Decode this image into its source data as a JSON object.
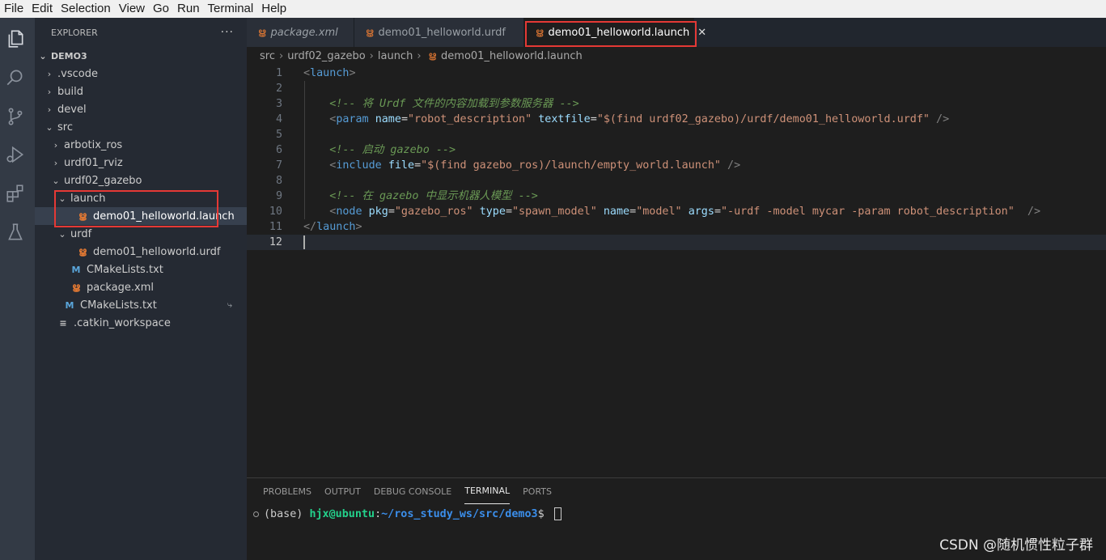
{
  "menubar": {
    "items": [
      "File",
      "Edit",
      "Selection",
      "View",
      "Go",
      "Run",
      "Terminal",
      "Help"
    ]
  },
  "activity_bar": {
    "icons": [
      "files-icon",
      "search-icon",
      "source-control-icon",
      "run-debug-icon",
      "extensions-icon",
      "testing-flask-icon"
    ]
  },
  "sidebar": {
    "title": "EXPLORER",
    "more": "···",
    "workspace": "DEMO3",
    "tree": [
      {
        "label": ".vscode",
        "type": "folder",
        "expanded": false
      },
      {
        "label": "build",
        "type": "folder",
        "expanded": false
      },
      {
        "label": "devel",
        "type": "folder",
        "expanded": false
      },
      {
        "label": "src",
        "type": "folder",
        "expanded": true
      },
      {
        "label": "arbotix_ros",
        "type": "folder",
        "expanded": false
      },
      {
        "label": "urdf01_rviz",
        "type": "folder",
        "expanded": false
      },
      {
        "label": "urdf02_gazebo",
        "type": "folder",
        "expanded": true
      },
      {
        "label": "launch",
        "type": "folder",
        "expanded": true
      },
      {
        "label": "demo01_helloworld.launch",
        "type": "rss-file"
      },
      {
        "label": "urdf",
        "type": "folder",
        "expanded": true
      },
      {
        "label": "demo01_helloworld.urdf",
        "type": "rss-file"
      },
      {
        "label": "CMakeLists.txt",
        "type": "cmake-file"
      },
      {
        "label": "package.xml",
        "type": "rss-file"
      },
      {
        "label": "CMakeLists.txt",
        "type": "cmake-file"
      },
      {
        "label": ".catkin_workspace",
        "type": "text-file"
      }
    ],
    "chevron_open": "⌄",
    "chevron_closed": "›",
    "rss_glyph": "ൠ",
    "cmake_glyph": "M",
    "text_glyph": "≡",
    "return_glyph": "⤷"
  },
  "tabs": [
    {
      "label": "package.xml",
      "italic": true,
      "active": false
    },
    {
      "label": "demo01_helloworld.urdf",
      "italic": false,
      "active": false
    },
    {
      "label": "demo01_helloworld.launch",
      "italic": false,
      "active": true,
      "close": "✕"
    }
  ],
  "breadcrumb": [
    "src",
    "urdf02_gazebo",
    "launch",
    "demo01_helloworld.launch"
  ],
  "editor": {
    "line_numbers": [
      "1",
      "2",
      "3",
      "4",
      "5",
      "6",
      "7",
      "8",
      "9",
      "10",
      "11",
      "12"
    ],
    "lines": [
      [
        [
          "bracket",
          "<"
        ],
        [
          "tag",
          "launch"
        ],
        [
          "bracket",
          ">"
        ]
      ],
      [],
      [
        [
          "plain",
          "    "
        ],
        [
          "cmt",
          "<!-- 将 Urdf 文件的内容加载到参数服务器 -->"
        ]
      ],
      [
        [
          "plain",
          "    "
        ],
        [
          "bracket",
          "<"
        ],
        [
          "tag",
          "param"
        ],
        [
          "plain",
          " "
        ],
        [
          "attr",
          "name"
        ],
        [
          "plain",
          "="
        ],
        [
          "str",
          "\"robot_description\""
        ],
        [
          "plain",
          " "
        ],
        [
          "attr",
          "textfile"
        ],
        [
          "plain",
          "="
        ],
        [
          "str",
          "\"$(find urdf02_gazebo)/urdf/demo01_helloworld.urdf\""
        ],
        [
          "plain",
          " "
        ],
        [
          "bracket",
          "/>"
        ]
      ],
      [],
      [
        [
          "plain",
          "    "
        ],
        [
          "cmt",
          "<!-- 启动 gazebo -->"
        ]
      ],
      [
        [
          "plain",
          "    "
        ],
        [
          "bracket",
          "<"
        ],
        [
          "tag",
          "include"
        ],
        [
          "plain",
          " "
        ],
        [
          "attr",
          "file"
        ],
        [
          "plain",
          "="
        ],
        [
          "str",
          "\"$(find gazebo_ros)/launch/empty_world.launch\""
        ],
        [
          "plain",
          " "
        ],
        [
          "bracket",
          "/>"
        ]
      ],
      [],
      [
        [
          "plain",
          "    "
        ],
        [
          "cmt",
          "<!-- 在 gazebo 中显示机器人模型 -->"
        ]
      ],
      [
        [
          "plain",
          "    "
        ],
        [
          "bracket",
          "<"
        ],
        [
          "tag",
          "node"
        ],
        [
          "plain",
          " "
        ],
        [
          "attr",
          "pkg"
        ],
        [
          "plain",
          "="
        ],
        [
          "str",
          "\"gazebo_ros\""
        ],
        [
          "plain",
          " "
        ],
        [
          "attr",
          "type"
        ],
        [
          "plain",
          "="
        ],
        [
          "str",
          "\"spawn_model\""
        ],
        [
          "plain",
          " "
        ],
        [
          "attr",
          "name"
        ],
        [
          "plain",
          "="
        ],
        [
          "str",
          "\"model\""
        ],
        [
          "plain",
          " "
        ],
        [
          "attr",
          "args"
        ],
        [
          "plain",
          "="
        ],
        [
          "str",
          "\"-urdf -model mycar -param robot_description\""
        ],
        [
          "plain",
          "  "
        ],
        [
          "bracket",
          "/>"
        ]
      ],
      [
        [
          "bracket",
          "</"
        ],
        [
          "tag",
          "launch"
        ],
        [
          "bracket",
          ">"
        ]
      ],
      []
    ]
  },
  "panel": {
    "tabs": [
      "PROBLEMS",
      "OUTPUT",
      "DEBUG CONSOLE",
      "TERMINAL",
      "PORTS"
    ],
    "active_tab": "TERMINAL",
    "terminal": {
      "env": "(base) ",
      "user": "hjx@ubuntu",
      "colon": ":",
      "path": "~/ros_study_ws/src/demo3",
      "prompt": "$ "
    }
  },
  "watermark": "CSDN @随机惯性粒子群",
  "colors": {
    "accent_red_box": "#e53935",
    "rss_orange": "#e37933",
    "cmake_blue": "#5aa6db"
  }
}
